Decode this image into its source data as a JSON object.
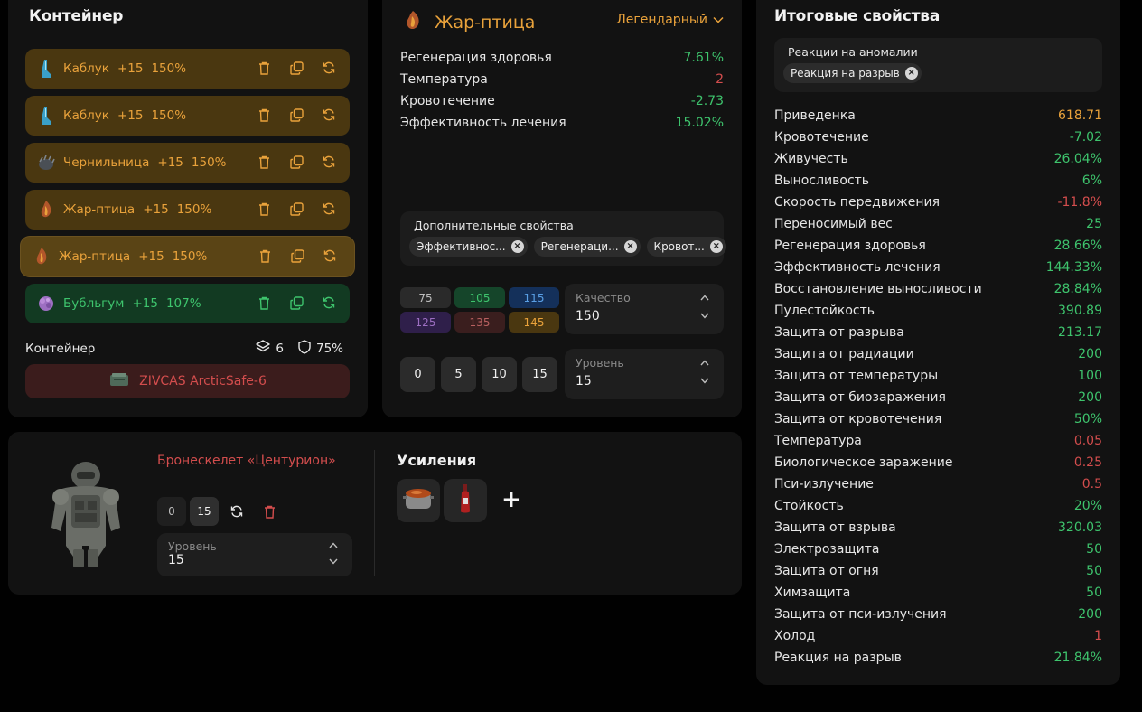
{
  "container": {
    "title": "Контейнер",
    "artifacts": [
      {
        "name": "Каблук",
        "plus": "+15",
        "percent": "150%",
        "icon": "kabluk-icon"
      },
      {
        "name": "Каблук",
        "plus": "+15",
        "percent": "150%",
        "icon": "kabluk-icon"
      },
      {
        "name": "Чернильница",
        "plus": "+15",
        "percent": "150%",
        "icon": "chernilnitsa-icon"
      },
      {
        "name": "Жар-птица",
        "plus": "+15",
        "percent": "150%",
        "icon": "zhar-ptitsa-icon"
      },
      {
        "name": "Жар-птица",
        "plus": "+15",
        "percent": "150%",
        "icon": "zhar-ptitsa-icon"
      },
      {
        "name": "Бубльгум",
        "plus": "+15",
        "percent": "107%",
        "icon": "bubblegum-icon"
      }
    ],
    "footer_label": "Контейнер",
    "slots": "6",
    "protection": "75%",
    "container_name": "ZIVCAS ArcticSafe-6"
  },
  "artifact": {
    "title": "Жар-птица",
    "rarity": "Легендарный",
    "stats": [
      {
        "label": "Регенерация здоровья",
        "value": "7.61%",
        "tone": "pos"
      },
      {
        "label": "Температура",
        "value": "2",
        "tone": "neg"
      },
      {
        "label": "Кровотечение",
        "value": "-2.73",
        "tone": "pos"
      },
      {
        "label": "Эффективность лечения",
        "value": "15.02%",
        "tone": "pos"
      }
    ],
    "extra_title": "Дополнительные свойства",
    "extra_chips": [
      "Эффективнос...",
      "Регенераци...",
      "Кровот..."
    ],
    "quality_buttons": [
      "75",
      "105",
      "115",
      "125",
      "135",
      "145"
    ],
    "quality_label": "Качество",
    "quality_value": "150",
    "level_buttons": [
      "0",
      "5",
      "10",
      "15"
    ],
    "level_label": "Уровень",
    "level_value": "15"
  },
  "armor": {
    "name": "Бронескелет «Центурион»",
    "level_buttons": [
      "0",
      "15"
    ],
    "level_label": "Уровень",
    "level_value": "15",
    "boosts_title": "Усиления",
    "add_label": "+"
  },
  "totals": {
    "title": "Итоговые свойства",
    "anomaly_title": "Реакции на аномалии",
    "anomaly_chip": "Реакция на разрыв",
    "rows": [
      {
        "label": "Приведенка",
        "value": "618.71",
        "tone": "gold"
      },
      {
        "label": "Кровотечение",
        "value": "-7.02",
        "tone": "pos"
      },
      {
        "label": "Живучесть",
        "value": "26.04%",
        "tone": "pos"
      },
      {
        "label": "Выносливость",
        "value": "6%",
        "tone": "pos"
      },
      {
        "label": "Скорость передвижения",
        "value": "-11.8%",
        "tone": "neg"
      },
      {
        "label": "Переносимый вес",
        "value": "25",
        "tone": "pos"
      },
      {
        "label": "Регенерация здоровья",
        "value": "28.66%",
        "tone": "pos"
      },
      {
        "label": "Эффективность лечения",
        "value": "144.33%",
        "tone": "pos"
      },
      {
        "label": "Восстановление выносливости",
        "value": "28.84%",
        "tone": "pos"
      },
      {
        "label": "Пулестойкость",
        "value": "390.89",
        "tone": "pos"
      },
      {
        "label": "Защита от разрыва",
        "value": "213.17",
        "tone": "pos"
      },
      {
        "label": "Защита от радиации",
        "value": "200",
        "tone": "pos"
      },
      {
        "label": "Защита от температуры",
        "value": "100",
        "tone": "pos"
      },
      {
        "label": "Защита от биозаражения",
        "value": "200",
        "tone": "pos"
      },
      {
        "label": "Защита от кровотечения",
        "value": "50%",
        "tone": "pos"
      },
      {
        "label": "Температура",
        "value": "0.05",
        "tone": "neg"
      },
      {
        "label": "Биологическое заражение",
        "value": "0.25",
        "tone": "neg"
      },
      {
        "label": "Пси-излучение",
        "value": "0.5",
        "tone": "neg"
      },
      {
        "label": "Стойкость",
        "value": "20%",
        "tone": "pos"
      },
      {
        "label": "Защита от взрыва",
        "value": "320.03",
        "tone": "pos"
      },
      {
        "label": "Электрозащита",
        "value": "50",
        "tone": "pos"
      },
      {
        "label": "Защита от огня",
        "value": "50",
        "tone": "pos"
      },
      {
        "label": "Химзащита",
        "value": "50",
        "tone": "pos"
      },
      {
        "label": "Защита от пси-излучения",
        "value": "200",
        "tone": "pos"
      },
      {
        "label": "Холод",
        "value": "1",
        "tone": "neg"
      },
      {
        "label": "Реакция на разрыв",
        "value": "21.84%",
        "tone": "pos"
      }
    ]
  },
  "colors": {
    "accent_gold": "#e9a23b",
    "positive": "#3ec46d",
    "negative": "#d34d4d"
  }
}
